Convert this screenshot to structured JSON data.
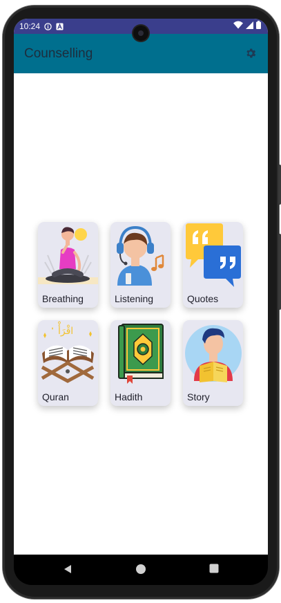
{
  "status_bar": {
    "time": "10:24",
    "icons": [
      "info-icon",
      "a-notification-icon",
      "wifi-icon",
      "signal-icon",
      "battery-icon"
    ]
  },
  "app_bar": {
    "title": "Counselling",
    "color": "#006f8e",
    "action_icon": "gear-icon"
  },
  "cards": [
    {
      "label": "Breathing",
      "icon": "meditation-illustration"
    },
    {
      "label": "Listening",
      "icon": "headphones-listener-illustration"
    },
    {
      "label": "Quotes",
      "icon": "quote-bubbles-illustration"
    },
    {
      "label": "Quran",
      "icon": "open-quran-illustration"
    },
    {
      "label": "Hadith",
      "icon": "hadith-book-illustration"
    },
    {
      "label": "Story",
      "icon": "reading-person-illustration"
    }
  ],
  "nav": [
    "back-icon",
    "home-icon",
    "recents-icon"
  ]
}
